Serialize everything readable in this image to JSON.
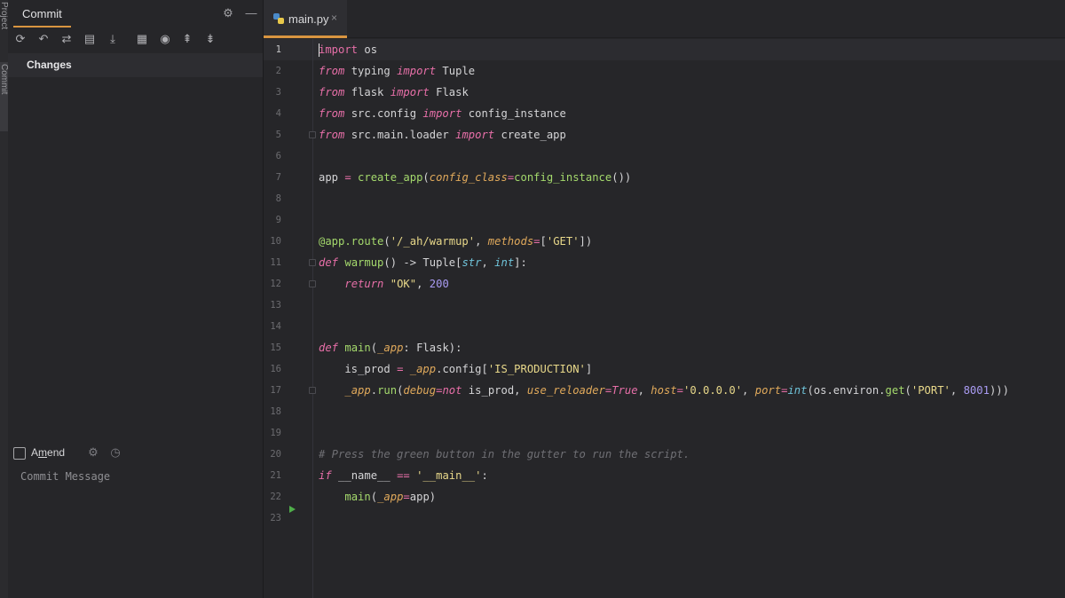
{
  "stripe": {
    "tabs": [
      "Project",
      "Commit"
    ]
  },
  "commit_panel": {
    "title": "Commit",
    "header_icons": [
      "gear-icon",
      "minimize-icon"
    ],
    "toolbar_icons": [
      "refresh-icon",
      "rollback-icon",
      "show-diff-icon",
      "view-icon",
      "update-icon",
      "group-by-icon",
      "preview-icon",
      "expand-all-icon",
      "collapse-all-icon"
    ],
    "changes_label": "Changes",
    "amend": {
      "label_prefix": "A",
      "label_underlined": "m",
      "label_suffix": "end",
      "checked": false
    },
    "commit_message_placeholder": "Commit Message"
  },
  "editor": {
    "tab": {
      "label": "main.py",
      "close_glyph": "×"
    },
    "current_line": 1,
    "line_numbers": [
      "1",
      "2",
      "3",
      "4",
      "5",
      "6",
      "7",
      "8",
      "9",
      "10",
      "11",
      "12",
      "13",
      "14",
      "15",
      "16",
      "17",
      "18",
      "19",
      "20",
      "21",
      "22",
      "23"
    ],
    "lines": [
      [
        {
          "t": "import",
          "c": "kw2"
        },
        {
          "t": " os",
          "c": ""
        }
      ],
      [
        {
          "t": "from",
          "c": "kw"
        },
        {
          "t": " typing ",
          "c": ""
        },
        {
          "t": "import",
          "c": "kw"
        },
        {
          "t": " Tuple",
          "c": ""
        }
      ],
      [
        {
          "t": "from",
          "c": "kw"
        },
        {
          "t": " flask ",
          "c": ""
        },
        {
          "t": "import",
          "c": "kw"
        },
        {
          "t": " Flask",
          "c": ""
        }
      ],
      [
        {
          "t": "from",
          "c": "kw"
        },
        {
          "t": " src.config ",
          "c": ""
        },
        {
          "t": "import",
          "c": "kw"
        },
        {
          "t": " config_instance",
          "c": ""
        }
      ],
      [
        {
          "t": "from",
          "c": "kw"
        },
        {
          "t": " src.main.loader ",
          "c": ""
        },
        {
          "t": "import",
          "c": "kw"
        },
        {
          "t": " create_app",
          "c": ""
        }
      ],
      [],
      [
        {
          "t": "app ",
          "c": ""
        },
        {
          "t": "=",
          "c": "kw2"
        },
        {
          "t": " ",
          "c": ""
        },
        {
          "t": "create_app",
          "c": "fn"
        },
        {
          "t": "(",
          "c": ""
        },
        {
          "t": "config_class",
          "c": "param"
        },
        {
          "t": "=",
          "c": "kw2"
        },
        {
          "t": "config_instance",
          "c": "fn"
        },
        {
          "t": "())",
          "c": ""
        }
      ],
      [],
      [],
      [
        {
          "t": "@app.route",
          "c": "deco"
        },
        {
          "t": "(",
          "c": ""
        },
        {
          "t": "'/_ah/warmup'",
          "c": "str"
        },
        {
          "t": ", ",
          "c": ""
        },
        {
          "t": "methods",
          "c": "param"
        },
        {
          "t": "=",
          "c": "kw2"
        },
        {
          "t": "[",
          "c": ""
        },
        {
          "t": "'GET'",
          "c": "str"
        },
        {
          "t": "])",
          "c": ""
        }
      ],
      [
        {
          "t": "def",
          "c": "kw"
        },
        {
          "t": " ",
          "c": ""
        },
        {
          "t": "warmup",
          "c": "fn"
        },
        {
          "t": "() -> Tuple[",
          "c": ""
        },
        {
          "t": "str",
          "c": "builtin"
        },
        {
          "t": ", ",
          "c": ""
        },
        {
          "t": "int",
          "c": "builtin"
        },
        {
          "t": "]:",
          "c": ""
        }
      ],
      [
        {
          "t": "    ",
          "c": ""
        },
        {
          "t": "return",
          "c": "kw"
        },
        {
          "t": " ",
          "c": ""
        },
        {
          "t": "\"OK\"",
          "c": "str"
        },
        {
          "t": ", ",
          "c": ""
        },
        {
          "t": "200",
          "c": "num"
        }
      ],
      [],
      [],
      [
        {
          "t": "def",
          "c": "kw"
        },
        {
          "t": " ",
          "c": ""
        },
        {
          "t": "main",
          "c": "fn"
        },
        {
          "t": "(",
          "c": ""
        },
        {
          "t": "_app",
          "c": "param"
        },
        {
          "t": ": Flask):",
          "c": ""
        }
      ],
      [
        {
          "t": "    is_prod ",
          "c": ""
        },
        {
          "t": "=",
          "c": "kw2"
        },
        {
          "t": " ",
          "c": ""
        },
        {
          "t": "_app",
          "c": "param"
        },
        {
          "t": ".config[",
          "c": ""
        },
        {
          "t": "'IS_PRODUCTION'",
          "c": "str"
        },
        {
          "t": "]",
          "c": ""
        }
      ],
      [
        {
          "t": "    ",
          "c": ""
        },
        {
          "t": "_app",
          "c": "param"
        },
        {
          "t": ".",
          "c": ""
        },
        {
          "t": "run",
          "c": "fn"
        },
        {
          "t": "(",
          "c": ""
        },
        {
          "t": "debug",
          "c": "param"
        },
        {
          "t": "=",
          "c": "kw2"
        },
        {
          "t": "not",
          "c": "kw"
        },
        {
          "t": " is_prod, ",
          "c": ""
        },
        {
          "t": "use_reloader",
          "c": "param"
        },
        {
          "t": "=",
          "c": "kw2"
        },
        {
          "t": "True",
          "c": "kw"
        },
        {
          "t": ", ",
          "c": ""
        },
        {
          "t": "host",
          "c": "param"
        },
        {
          "t": "=",
          "c": "kw2"
        },
        {
          "t": "'0.0.0.0'",
          "c": "str"
        },
        {
          "t": ", ",
          "c": ""
        },
        {
          "t": "port",
          "c": "param"
        },
        {
          "t": "=",
          "c": "kw2"
        },
        {
          "t": "int",
          "c": "builtin"
        },
        {
          "t": "(os.environ.",
          "c": ""
        },
        {
          "t": "get",
          "c": "fn"
        },
        {
          "t": "(",
          "c": ""
        },
        {
          "t": "'PORT'",
          "c": "str"
        },
        {
          "t": ", ",
          "c": ""
        },
        {
          "t": "8001",
          "c": "num"
        },
        {
          "t": "))",
          "c": ""
        },
        {
          "t": ")",
          "c": ""
        }
      ],
      [],
      [],
      [
        {
          "t": "# Press the green button in the gutter to run the script.",
          "c": "comment"
        }
      ],
      [
        {
          "t": "if",
          "c": "kw"
        },
        {
          "t": " __name__ ",
          "c": ""
        },
        {
          "t": "==",
          "c": "kw2"
        },
        {
          "t": " ",
          "c": ""
        },
        {
          "t": "'__main__'",
          "c": "str"
        },
        {
          "t": ":",
          "c": ""
        }
      ],
      [
        {
          "t": "    ",
          "c": ""
        },
        {
          "t": "main",
          "c": "fn"
        },
        {
          "t": "(",
          "c": ""
        },
        {
          "t": "_app",
          "c": "param"
        },
        {
          "t": "=",
          "c": "kw2"
        },
        {
          "t": "app)",
          "c": ""
        }
      ],
      []
    ]
  }
}
